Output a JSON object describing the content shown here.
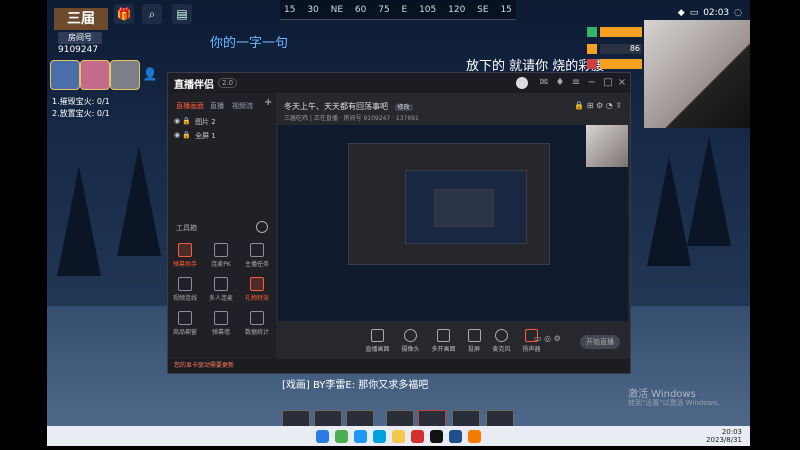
{
  "compass": [
    "15",
    "30",
    "NE",
    "60",
    "75",
    "E",
    "105",
    "120",
    "SE",
    "15"
  ],
  "hud": {
    "logo_text": "三届",
    "room_label": "房间号",
    "room_id": "9109247",
    "tasks": [
      "1.摧毁宝火: 0/1",
      "2.放置宝火: 0/1"
    ]
  },
  "lyrics": {
    "line1": "你的一字一句",
    "line2": "放下的 就请你 烧的彩腰"
  },
  "stats": [
    {
      "value": "",
      "color": "#f5a020",
      "icon": "heart-icon"
    },
    {
      "value": "86",
      "color": "#2a3140",
      "icon": "moon-icon"
    },
    {
      "value": "",
      "color": "#f5a020",
      "icon": "flag-icon"
    }
  ],
  "system": {
    "time": "02:03"
  },
  "app": {
    "name": "直播伴侣",
    "version": "2.0",
    "left_tabs": [
      "直播画面",
      "直播",
      "视频流"
    ],
    "layers": [
      {
        "icons": "◉ 🔒",
        "label": "图片 2"
      },
      {
        "icons": "◉ 🔒",
        "label": "全屏 1"
      }
    ],
    "tools_title": "工具箱",
    "tools": [
      {
        "label": "弹幕助手",
        "red": true
      },
      {
        "label": "连麦PK",
        "red": false
      },
      {
        "label": "主播任务",
        "red": false
      },
      {
        "label": "视频连线",
        "red": false
      },
      {
        "label": "多人连麦",
        "red": false
      },
      {
        "label": "礼物特效",
        "red": true
      },
      {
        "label": "商品橱窗",
        "red": false
      },
      {
        "label": "弹幕墙",
        "red": false
      },
      {
        "label": "数据统计",
        "red": false
      }
    ],
    "stream_title": "冬天上午、天天都有回荡事吧",
    "stream_tag": "修改",
    "stream_meta": "三届吃鸡 | 正在直播 · 房间号 9109247 · 137691",
    "bottom_tools": [
      "直播画面",
      "摄像头",
      "多开画面",
      "投屏",
      "麦克风",
      "扬声器"
    ],
    "start_live": "开始直播",
    "status": "您的显卡驱动需要更新"
  },
  "danmaku": "[戏画] BY李雷E: 那你又求多福吧",
  "windows_watermark": {
    "line1": "激活 Windows",
    "line2": "转到\"设置\"以激活 Windows。"
  },
  "taskbar": {
    "time": "20:03",
    "date": "2023/8/31"
  }
}
